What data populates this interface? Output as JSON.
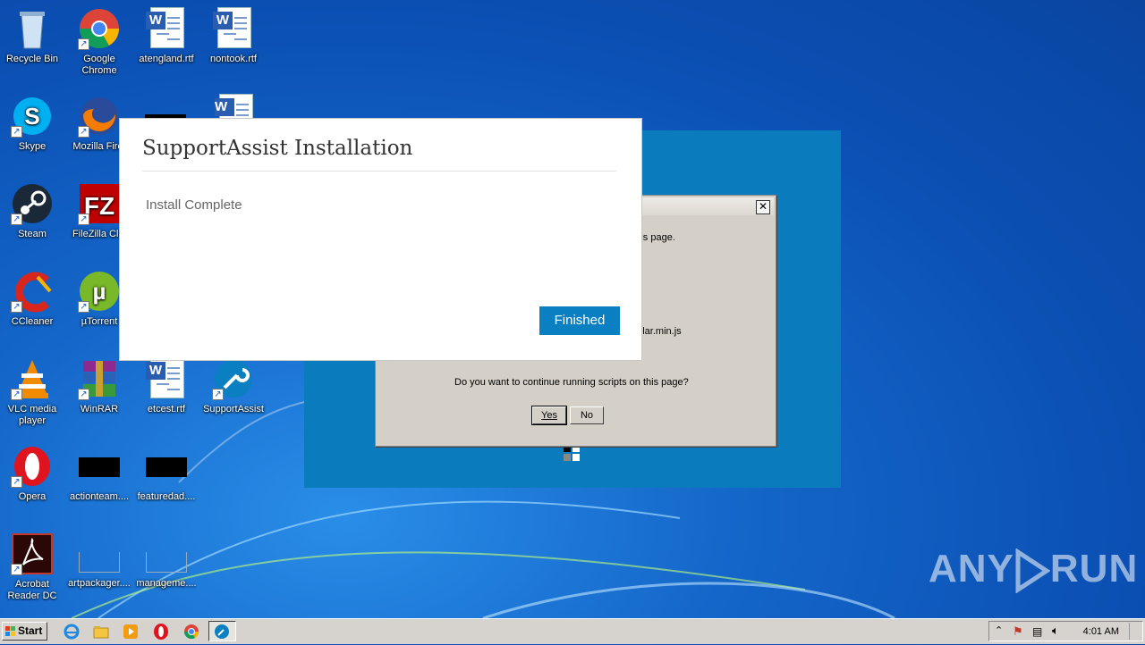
{
  "desktop": {
    "icons": [
      {
        "label": "Recycle Bin"
      },
      {
        "label": "Google Chrome"
      },
      {
        "label": "atengland.rtf"
      },
      {
        "label": "nontook.rtf"
      },
      {
        "label": "Skype"
      },
      {
        "label": "Mozilla Firef"
      },
      {
        "label": "Steam"
      },
      {
        "label": "FileZilla Clie"
      },
      {
        "label": "CCleaner"
      },
      {
        "label": "µTorrent"
      },
      {
        "label": "VLC media player"
      },
      {
        "label": "WinRAR"
      },
      {
        "label": "etcest.rtf"
      },
      {
        "label": "SupportAssist"
      },
      {
        "label": "Opera"
      },
      {
        "label": "actionteam...."
      },
      {
        "label": "featuredad...."
      },
      {
        "label": "Acrobat Reader DC"
      },
      {
        "label": "artpackager...."
      },
      {
        "label": "manageme...."
      }
    ]
  },
  "script_dialog": {
    "line1": "n this page.",
    "line2": "gular.min.js",
    "question": "Do you want to continue running scripts on this page?",
    "yes_label": "Yes",
    "no_label": "No",
    "close_glyph": "✕"
  },
  "support_dialog": {
    "title": "SupportAssist Installation",
    "message": "Install Complete",
    "finish_label": "Finished",
    "accent": "#0a7fc1"
  },
  "watermark": {
    "left": "ANY",
    "right": "RUN"
  },
  "taskbar": {
    "start_label": "Start",
    "clock": "4:01 AM"
  }
}
